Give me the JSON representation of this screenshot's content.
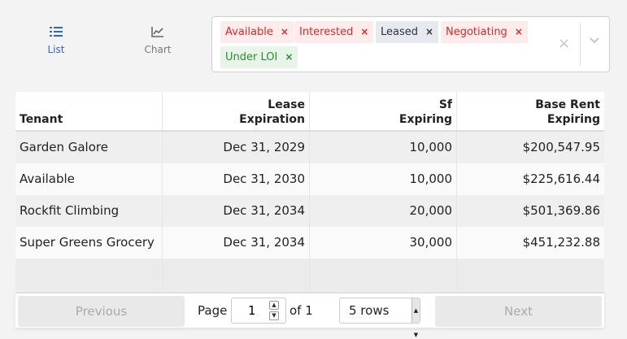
{
  "view": {
    "list_label": "List",
    "chart_label": "Chart"
  },
  "filters": {
    "tags": [
      {
        "label": "Available",
        "color": "#d62a2a"
      },
      {
        "label": "Interested",
        "color": "#d62a2a"
      },
      {
        "label": "Leased",
        "color": "#2a3244"
      },
      {
        "label": "Negotiating",
        "color": "#d62a2a"
      },
      {
        "label": "Under LOI",
        "color": "#2b8b35"
      }
    ],
    "remove_glyph": "×",
    "clear_glyph": "×"
  },
  "table": {
    "headers": [
      {
        "line1": "",
        "line2": "Tenant"
      },
      {
        "line1": "Lease",
        "line2": "Expiration"
      },
      {
        "line1": "Sf",
        "line2": "Expiring"
      },
      {
        "line1": "Base Rent",
        "line2": "Expiring"
      }
    ],
    "rows": [
      [
        "Garden Galore",
        "Dec 31, 2029",
        "10,000",
        "$200,547.95"
      ],
      [
        "Available",
        "Dec 31, 2030",
        "10,000",
        "$225,616.44"
      ],
      [
        "Rockfit Climbing",
        "Dec 31, 2034",
        "20,000",
        "$501,369.86"
      ],
      [
        "Super Greens Grocery",
        "Dec 31, 2034",
        "30,000",
        "$451,232.88"
      ]
    ]
  },
  "pagination": {
    "previous_label": "Previous",
    "next_label": "Next",
    "page_label": "Page",
    "page_value": "1",
    "of_label": "of 1",
    "rows_option": "5 rows"
  }
}
